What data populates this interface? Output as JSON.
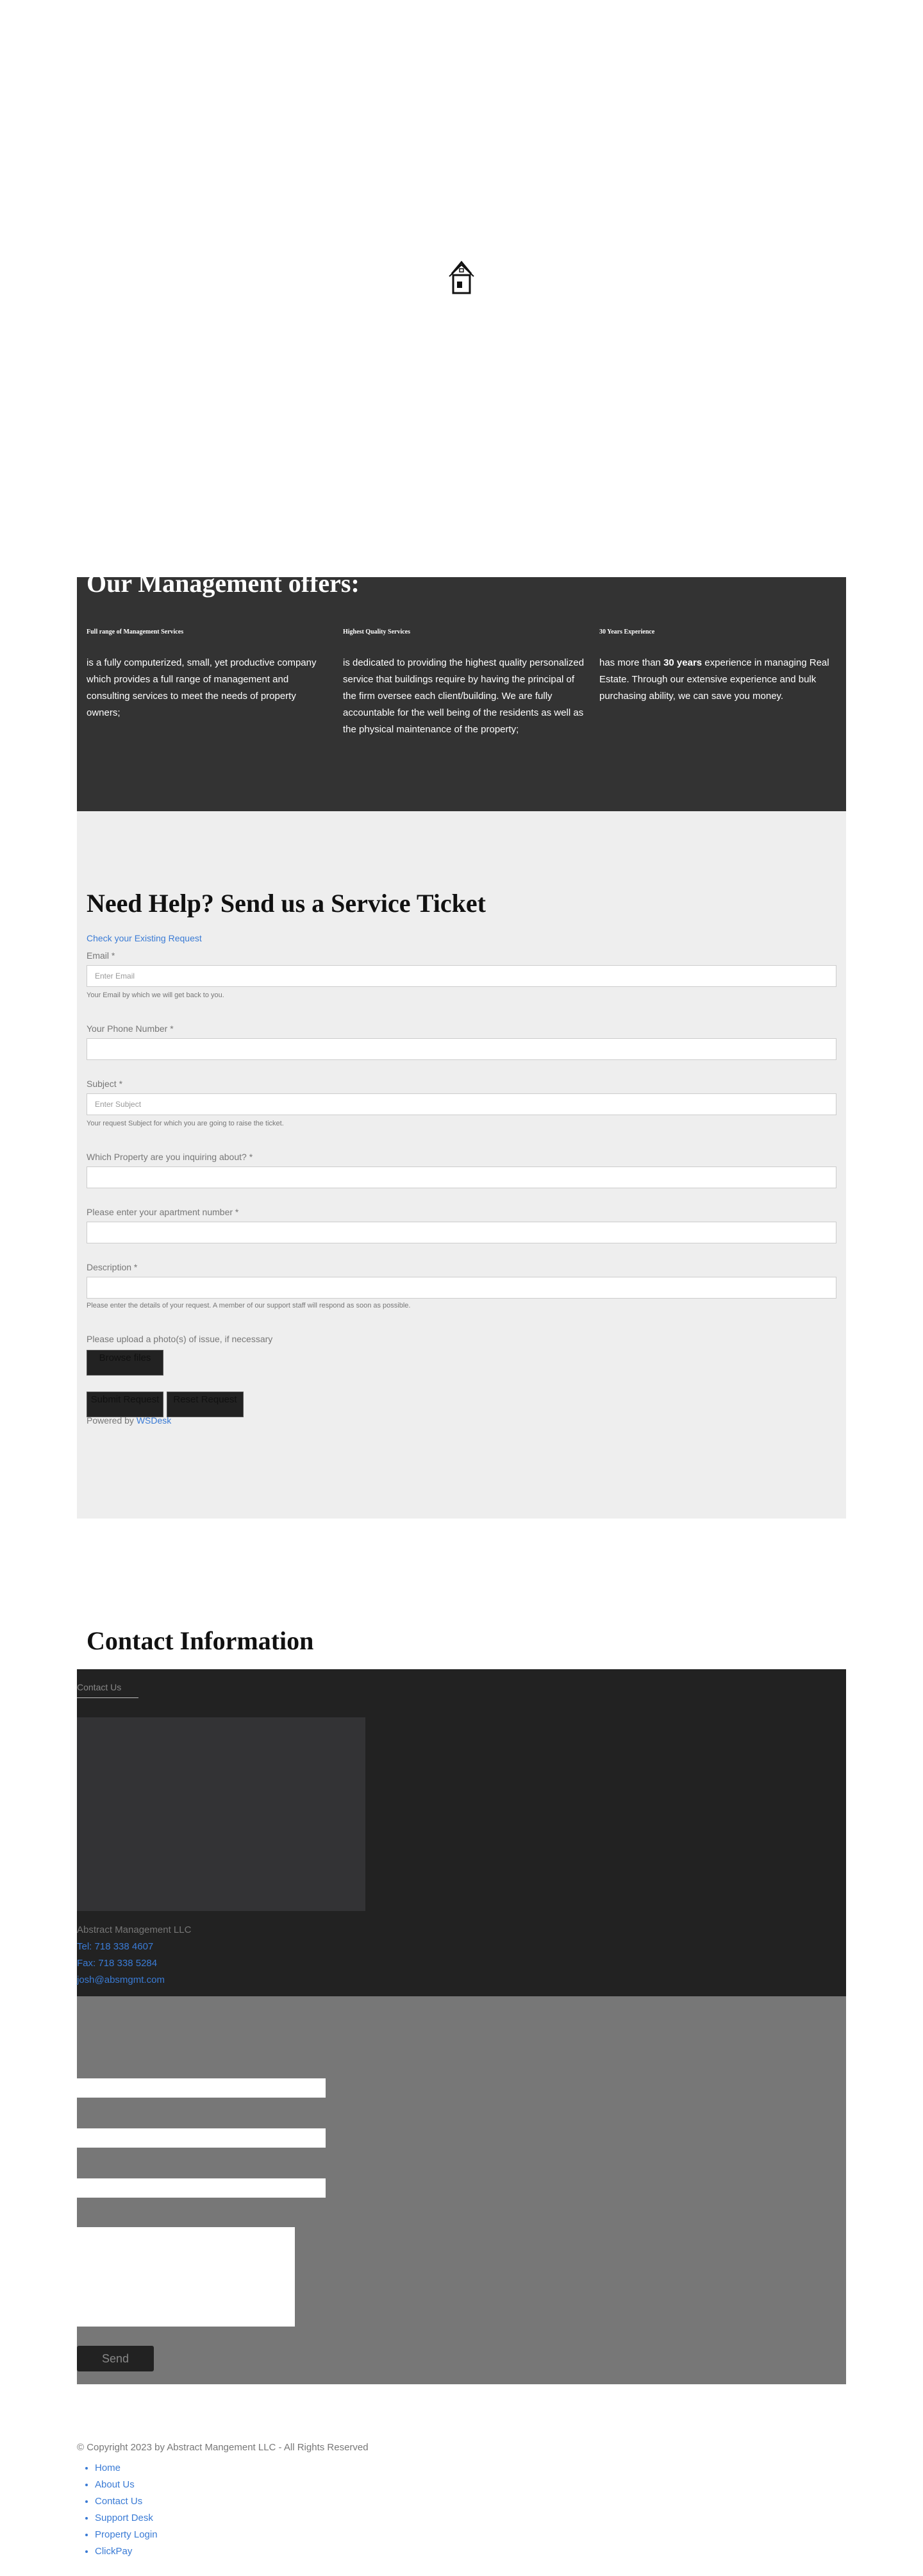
{
  "logo": {
    "icon": "house-logo-icon"
  },
  "offers": {
    "title": "Our Management offers:",
    "columns": [
      {
        "heading": "Full range of Management Services",
        "text": "is a fully computerized, small, yet productive company which provides a full range of management and consulting services to meet the needs of property owners;"
      },
      {
        "heading": "Highest Quality Services",
        "text": "is dedicated to providing the highest quality personalized service that buildings require by having the principal of the firm oversee each client/building. We are fully accountable for the well being of the residents as well as the physical maintenance of the property;"
      },
      {
        "heading": "30 Years Experience",
        "text_before": "has more than ",
        "text_bold": "30 years",
        "text_after": " experience in managing Real Estate. Through our extensive experience and bulk purchasing ability, we can save you money."
      }
    ]
  },
  "ticket": {
    "title": "Need Help? Send us a Service Ticket",
    "check_link": "Check your Existing Request",
    "email_label": "Email *",
    "email_placeholder": "Enter Email",
    "email_hint": "Your Email by which we will get back to you.",
    "phone_label": "Your Phone Number *",
    "subject_label": "Subject *",
    "subject_placeholder": "Enter Subject",
    "subject_hint": "Your request Subject for which you are going to raise the ticket.",
    "property_label": "Which Property are you inquiring about? *",
    "apartment_label": "Please enter your apartment number *",
    "description_label": "Description *",
    "description_hint": "Please enter the details of your request. A member of our support staff will respond as soon as possible.",
    "upload_label": "Please upload a photo(s) of issue, if necessary",
    "browse_button": "Browse files",
    "submit_button": "Submit Request",
    "reset_button": "Reset Request",
    "powered_prefix": "Powered by ",
    "powered_link": "WSDesk"
  },
  "contact": {
    "title": "Contact Information",
    "tab": "Contact Us",
    "company": "Abstract Management LLC",
    "tel": "Tel: 718 338 4607",
    "fax": "Fax: 718 338 5284",
    "email": "josh@absmgmt.com",
    "send_button": "Send"
  },
  "footer": {
    "copyright": "© Copyright 2023 by Abstract Mangement LLC - All Rights Reserved",
    "links": [
      "Home",
      "About Us",
      "Contact Us",
      "Support Desk",
      "Property Login",
      "ClickPay"
    ]
  },
  "colors": {
    "link": "#3a7bd5",
    "dark": "#333333",
    "darker": "#222222",
    "gray": "#777777",
    "light": "#eeeeee"
  }
}
